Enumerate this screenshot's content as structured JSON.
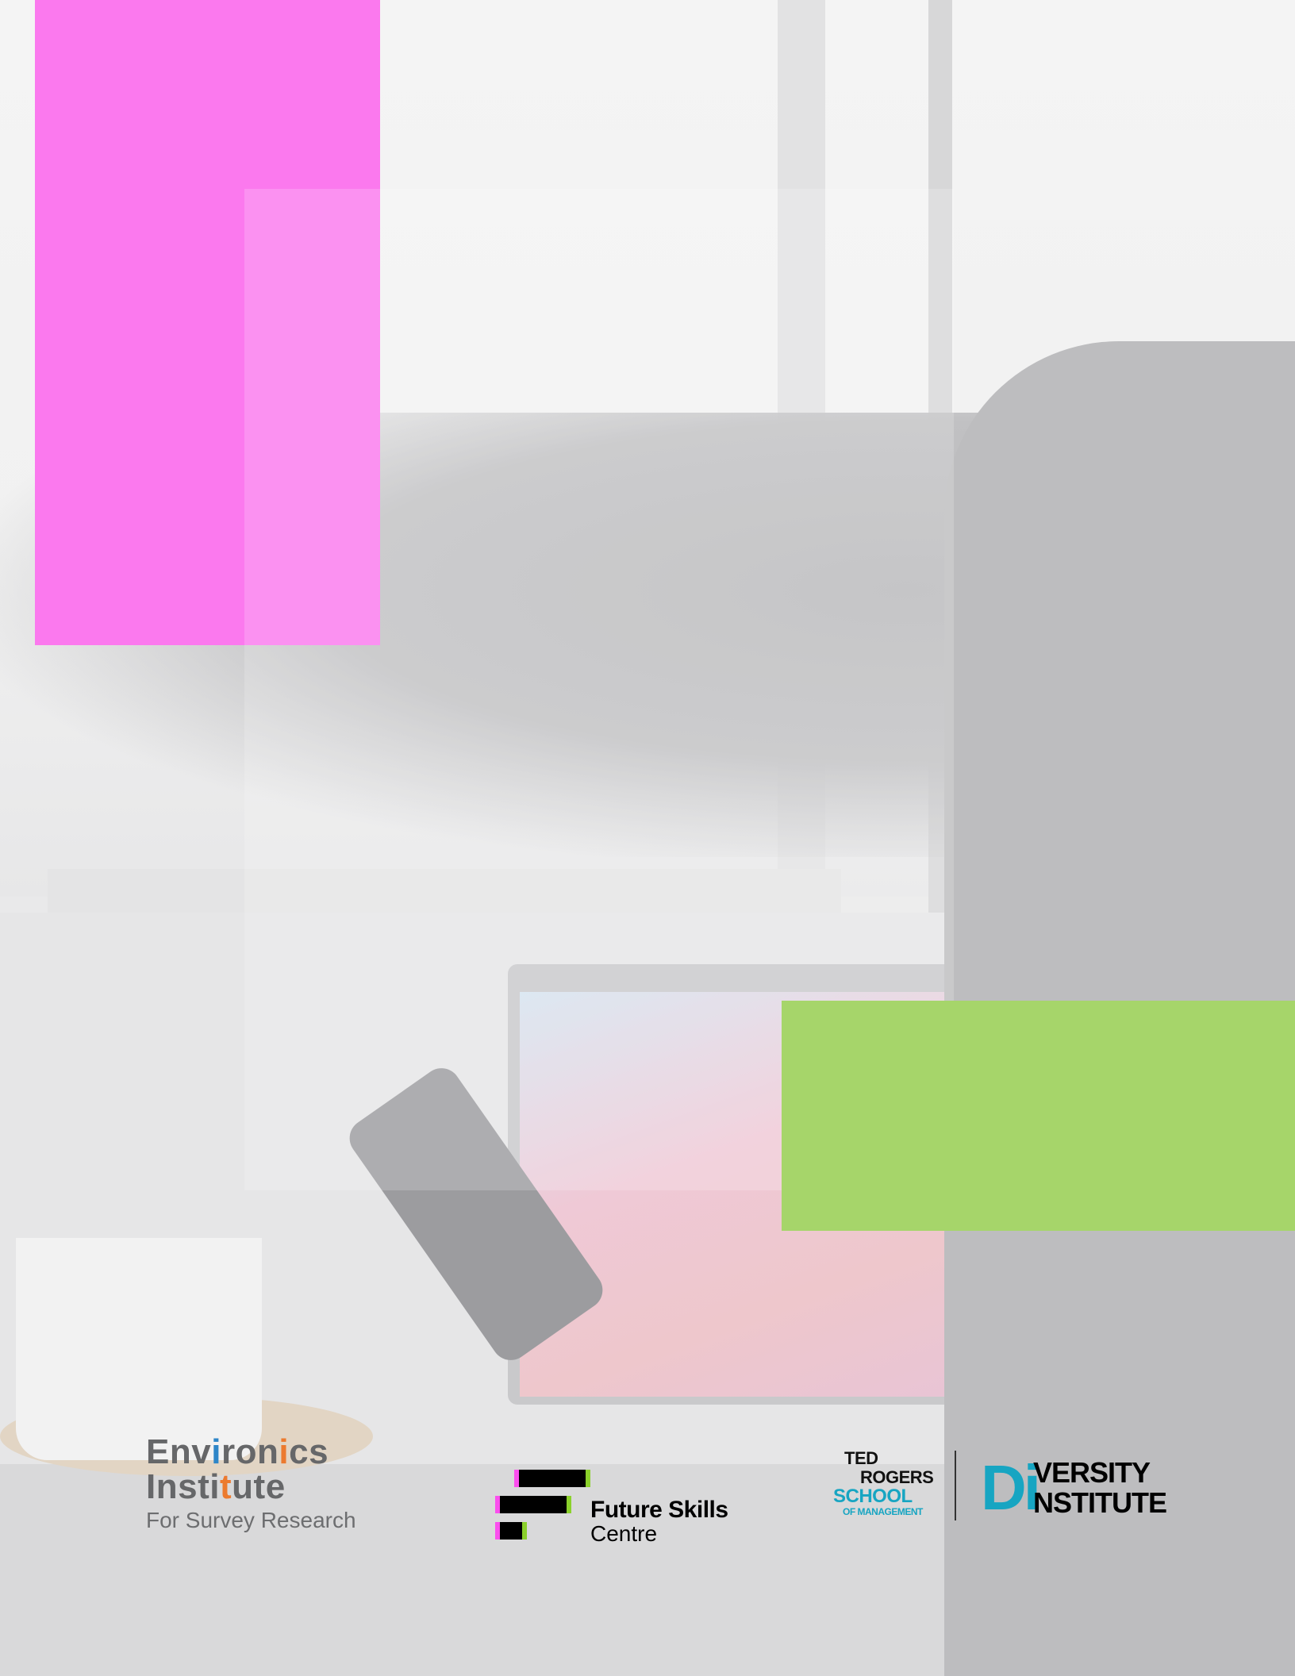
{
  "colors": {
    "magenta_block": "#fb79ee",
    "green_block": "#a6d56a",
    "diversity_accent": "#17a5c2",
    "environics_blue": "#2e86c8",
    "environics_orange": "#ec7a2e"
  },
  "logos": {
    "environics": {
      "line1": "Environics",
      "line2": "Institute",
      "line3": "For Survey Research"
    },
    "future_skills": {
      "line1": "Future Skills",
      "line2": "Centre"
    },
    "ted_rogers": {
      "line1": "TED",
      "line2": "ROGERS",
      "line3": "SCHOOL",
      "line4": "OF MANAGEMENT"
    },
    "diversity_institute": {
      "initials": "Di",
      "line1": "VERSITY",
      "line2": "NSTITUTE"
    }
  }
}
